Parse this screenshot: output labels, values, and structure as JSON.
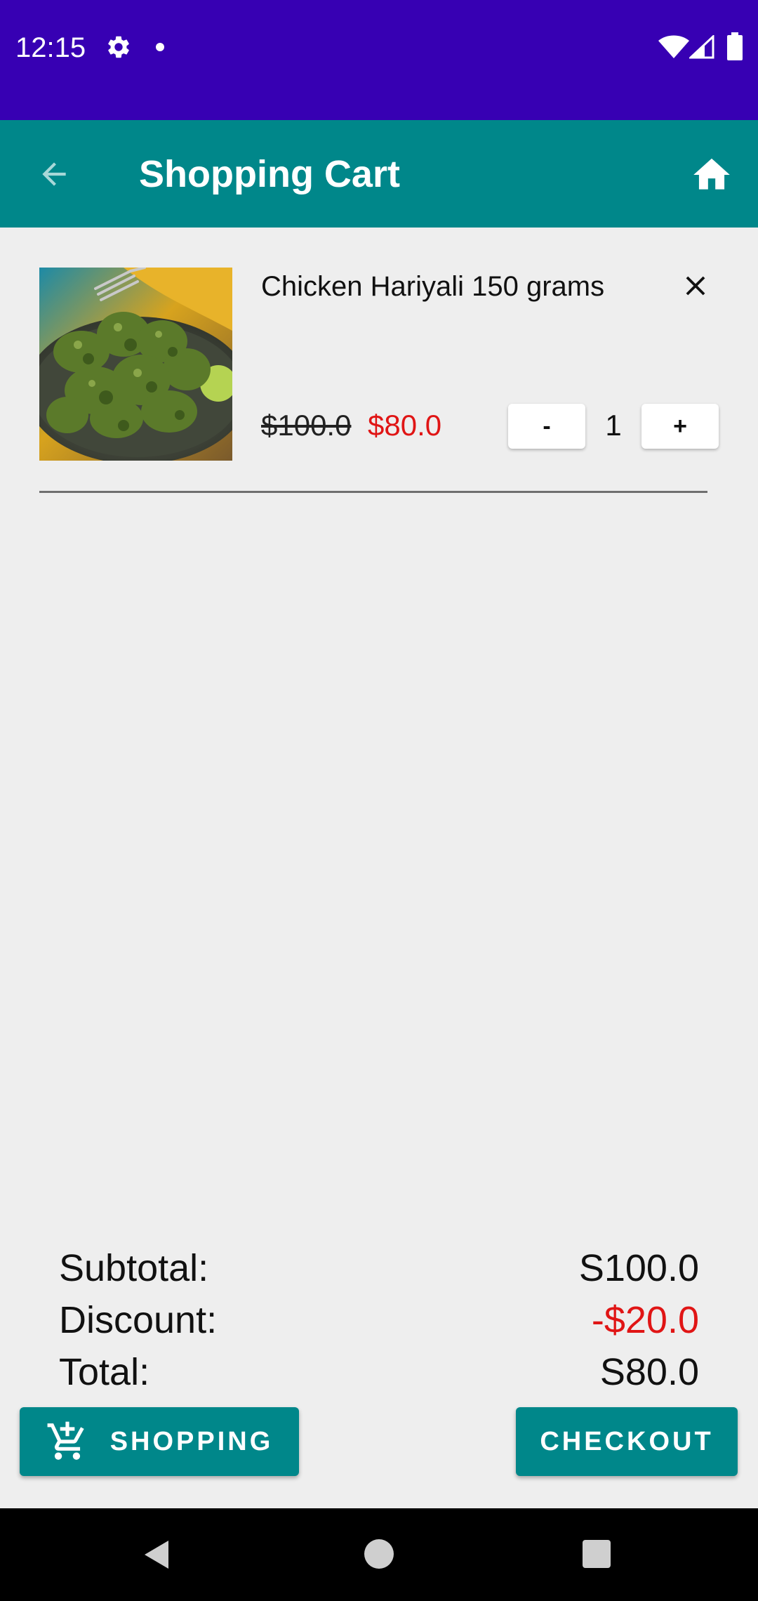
{
  "status_bar": {
    "time": "12:15",
    "icons": [
      "gear-icon",
      "notification-dot",
      "wifi-icon",
      "signal-icon",
      "battery-icon"
    ]
  },
  "app_bar": {
    "title": "Shopping Cart",
    "back_icon": "arrow-back-icon",
    "home_icon": "home-icon"
  },
  "cart": {
    "items": [
      {
        "name": "Chicken Hariyali 150 grams",
        "original_price": "$100.0",
        "discounted_price": "$80.0",
        "quantity": "1",
        "minus_label": "-",
        "plus_label": "+",
        "remove_icon": "close-icon"
      }
    ]
  },
  "summary": {
    "subtotal_label": "Subtotal:",
    "subtotal_value": "S100.0",
    "discount_label": "Discount:",
    "discount_value": "-$20.0",
    "total_label": "Total:",
    "total_value": "S80.0"
  },
  "actions": {
    "shopping_label": "SHOPPING",
    "shopping_icon": "add-to-cart-icon",
    "checkout_label": "CHECKOUT"
  },
  "colors": {
    "status_bar": "#3700b3",
    "app_bar": "#00878a",
    "accent": "#00878a",
    "discount": "#e01515",
    "background": "#eeeeee"
  }
}
